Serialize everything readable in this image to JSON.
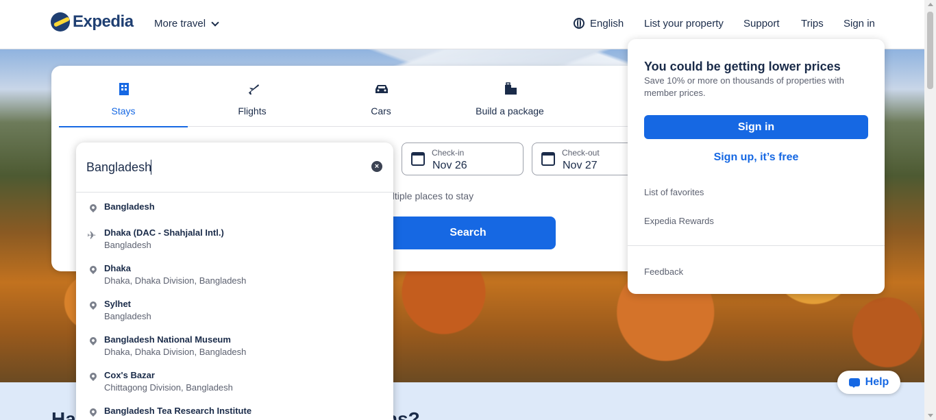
{
  "header": {
    "logo_text": "Expedia",
    "more_travel": "More travel",
    "language": "English",
    "list_property": "List your property",
    "support": "Support",
    "trips": "Trips",
    "sign_in": "Sign in"
  },
  "search": {
    "tabs": [
      {
        "label": "Stays",
        "icon": "building-icon",
        "active": true
      },
      {
        "label": "Flights",
        "icon": "airplane-icon",
        "active": false
      },
      {
        "label": "Cars",
        "icon": "car-icon",
        "active": false
      },
      {
        "label": "Build a package",
        "icon": "package-icon",
        "active": false
      }
    ],
    "destination_value": "Bangladesh",
    "check_in_label": "Check-in",
    "check_in_value": "Nov 26",
    "check_out_label": "Check-out",
    "check_out_value": "Nov 27",
    "multi_places_text": "ultiple places to stay",
    "search_button": "Search"
  },
  "autocomplete": [
    {
      "title": "Bangladesh",
      "subtitle": "",
      "icon": "location-pin-icon"
    },
    {
      "title": "Dhaka (DAC - Shahjalal Intl.)",
      "subtitle": "Bangladesh",
      "icon": "airplane-icon"
    },
    {
      "title": "Dhaka",
      "subtitle": "Dhaka, Dhaka Division, Bangladesh",
      "icon": "location-pin-icon"
    },
    {
      "title": "Sylhet",
      "subtitle": "Bangladesh",
      "icon": "location-pin-icon"
    },
    {
      "title": "Bangladesh National Museum",
      "subtitle": "Dhaka, Dhaka Division, Bangladesh",
      "icon": "location-pin-icon"
    },
    {
      "title": "Cox's Bazar",
      "subtitle": "Chittagong Division, Bangladesh",
      "icon": "location-pin-icon"
    },
    {
      "title": "Bangladesh Tea Research Institute",
      "subtitle": "",
      "icon": "location-pin-icon"
    }
  ],
  "popover": {
    "title": "You could be getting lower prices",
    "subtitle": "Save 10% or more on thousands of properties with member prices.",
    "sign_in": "Sign in",
    "sign_up": "Sign up, it’s free",
    "favorites": "List of favorites",
    "rewards": "Expedia Rewards",
    "feedback": "Feedback"
  },
  "below": {
    "title_left": "Ha",
    "title_right": "ns?"
  },
  "help": {
    "label": "Help"
  },
  "colors": {
    "brand_blue": "#1668e3",
    "navy": "#1a2b49",
    "logo_yellow": "#fdd835"
  }
}
